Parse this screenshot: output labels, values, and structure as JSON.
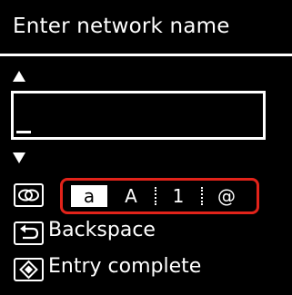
{
  "screen": {
    "title": "Enter network name",
    "input": {
      "value": ""
    },
    "modes": [
      {
        "label": "a",
        "selected": true
      },
      {
        "label": "A",
        "selected": false
      },
      {
        "label": "1",
        "selected": false
      },
      {
        "label": "@",
        "selected": false
      }
    ],
    "backspace_label": "Backspace",
    "entry_complete_label": "Entry complete",
    "icons": {
      "up": "up-arrow-icon",
      "down": "down-arrow-icon",
      "mode_key": "cycle-icon",
      "back_key": "back-arrow-icon",
      "ok_key": "ok-diamond-icon"
    },
    "colors": {
      "background": "#000000",
      "foreground": "#ffffff",
      "highlight_frame": "#e2231a"
    }
  }
}
